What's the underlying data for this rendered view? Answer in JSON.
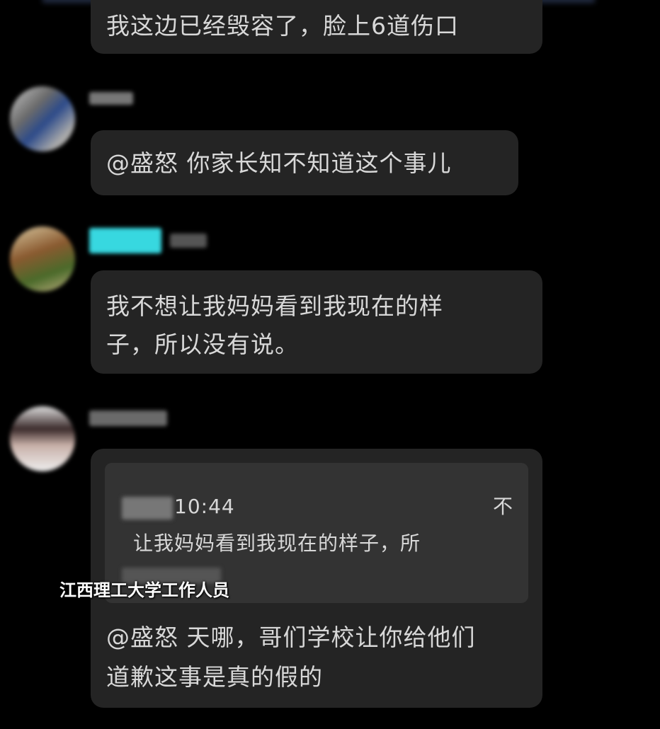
{
  "messages": [
    {
      "text": "我这边已经毁容了，脸上6道伤口"
    },
    {
      "text": "@盛怒 你家长知不知道这个事儿"
    },
    {
      "lines": [
        "我不想让我妈妈看到我现在的样",
        "子，所以没有说。"
      ]
    },
    {
      "quote": {
        "time": "10:44",
        "flag": "不",
        "text": "让我妈妈看到我现在的样子，所"
      },
      "lines": [
        "@盛怒 天哪，哥们学校让你给他们",
        "道歉这事是真的假的"
      ]
    }
  ],
  "caption": "江西理工大学工作人员",
  "colors": {
    "background": "#000000",
    "bubble": "#242424",
    "quote": "#333333",
    "name_highlight": "#37d8e0"
  }
}
